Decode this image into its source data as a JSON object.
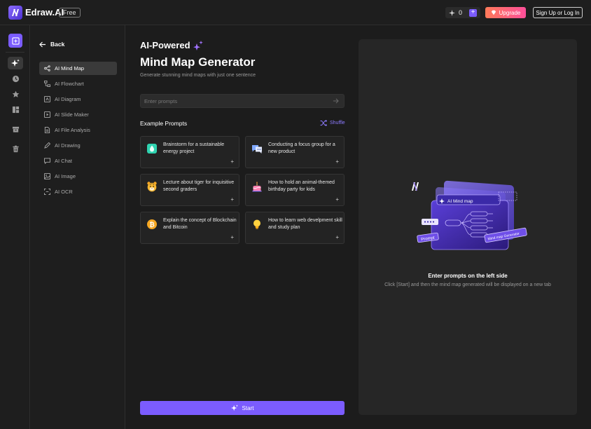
{
  "app": {
    "name": "Edraw.AI",
    "badge": "Free"
  },
  "header": {
    "credits": "0",
    "upgrade_label": "Upgrade",
    "signup_label": "Sign Up or Log In"
  },
  "rail": {
    "icons": [
      "new-file-icon",
      "ai-sparkle-icon",
      "clock-icon",
      "star-icon",
      "templates-icon",
      "archive-icon",
      "trash-icon"
    ]
  },
  "sidemenu": {
    "back_label": "Back",
    "items": [
      {
        "label": "AI Mind Map",
        "icon": "mindmap-icon",
        "active": true
      },
      {
        "label": "AI Flowchart",
        "icon": "flowchart-icon"
      },
      {
        "label": "AI Diagram",
        "icon": "diagram-icon"
      },
      {
        "label": "AI Slide Maker",
        "icon": "slide-icon"
      },
      {
        "label": "AI File Analysis",
        "icon": "file-icon"
      },
      {
        "label": "AI Drawing",
        "icon": "drawing-icon"
      },
      {
        "label": "AI Chat",
        "icon": "chat-icon"
      },
      {
        "label": "AI Image",
        "icon": "image-icon"
      },
      {
        "label": "AI OCR",
        "icon": "ocr-icon"
      }
    ]
  },
  "main": {
    "title_line1": "AI-Powered",
    "title_line2": "Mind Map Generator",
    "subtitle": "Generate stunning mind maps with just one sentence",
    "input_placeholder": "Enter prompts",
    "examples_title": "Example Prompts",
    "shuffle_label": "Shuffle",
    "prompts": [
      {
        "text": "Brainstorm for a sustainable energy project",
        "icon": "energy-icon"
      },
      {
        "text": "Conducting a focus group for a new product",
        "icon": "chat-bubbles-icon"
      },
      {
        "text": "Lecture about tiger for inquisitive second graders",
        "icon": "tiger-icon"
      },
      {
        "text": "How to hold an animal-themed birthday party for kids",
        "icon": "cake-icon"
      },
      {
        "text": "Explain the concept of Blockchain and Bitcoin",
        "icon": "bitcoin-icon"
      },
      {
        "text": "How to learn web develpment skill and study plan",
        "icon": "lightbulb-icon"
      }
    ],
    "start_label": "Start"
  },
  "preview": {
    "illustration_label": "AI Mind map",
    "illustration_tag1": "Prompt",
    "illustration_tag2": "Mind map Generator",
    "empty_title": "Enter prompts on the left side",
    "empty_subtitle": "Click [Start] and then the mind map generated will be displayed on a new tab"
  },
  "colors": {
    "accent": "#7b5cff",
    "background": "#1c1c1c",
    "panel": "#262626"
  }
}
